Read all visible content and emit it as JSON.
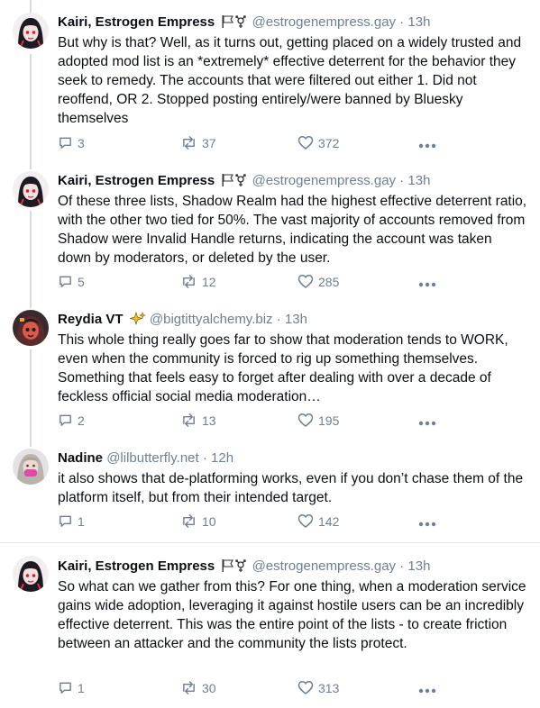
{
  "posts": [
    {
      "author": "Kairi, Estrogen Empress",
      "handle": "@estrogenempress.gay",
      "separator": "·",
      "time": "13h",
      "text": "But why is that? Well, as it turns out, getting placed on a widely trusted and adopted mod list is an *extremely* effective deterrent for the behavior they seek to remedy. The accounts that were filtered out either 1. Did not reoffend, OR 2. Stopped posting entirely/were banned by Bluesky themselves",
      "replies": "3",
      "reposts": "37",
      "likes": "372",
      "avatar": "kairi-avatar",
      "badges": [
        "flag-icon",
        "transgender-symbol-icon"
      ]
    },
    {
      "author": "Kairi, Estrogen Empress",
      "handle": "@estrogenempress.gay",
      "separator": "·",
      "time": "13h",
      "text": "Of these three lists, Shadow Realm had the highest effective deterrent ratio, with the other two tied for 50%. The vast majority of accounts removed from Shadow were Invalid Handle returns, indicating the account was taken down by moderators, or deleted by the user.",
      "replies": "5",
      "reposts": "12",
      "likes": "285",
      "avatar": "kairi-avatar",
      "badges": [
        "flag-icon",
        "transgender-symbol-icon"
      ]
    },
    {
      "author": "Reydia VT",
      "handle": "@bigtittyalchemy.biz",
      "separator": "·",
      "time": "13h",
      "text": "This whole thing really goes far to show that moderation tends to WORK, even when the community is forced to rig up something themselves. Something that feels easy to forget after dealing with over a decade of feckless official social media moderation…",
      "replies": "2",
      "reposts": "13",
      "likes": "195",
      "avatar": "reydia-avatar",
      "badges": [
        "sparkle-icon"
      ]
    },
    {
      "author": "Nadine",
      "handle": "@lilbutterfly.net",
      "separator": "·",
      "time": "12h",
      "text": "it also shows that de-platforming works, even if you don’t chase them of the platform itself, but from their intended target.",
      "replies": "1",
      "reposts": "10",
      "likes": "142",
      "avatar": "nadine-avatar",
      "badges": []
    },
    {
      "author": "Kairi, Estrogen Empress",
      "handle": "@estrogenempress.gay",
      "separator": "·",
      "time": "13h",
      "text": "So what can we gather from this? For one thing, when a moderation service gains wide adoption, leveraging it against hostile users can be an incredibly effective deterrent. This was the entire point of the lists - to create friction between an attacker and the community the lists protect.",
      "replies": "1",
      "reposts": "30",
      "likes": "313",
      "avatar": "kairi-avatar",
      "badges": [
        "flag-icon",
        "transgender-symbol-icon"
      ]
    }
  ],
  "colors": {
    "muted": "#6f7f8f",
    "divider": "#dfe4ea",
    "thread_line": "#d4dbe2"
  }
}
